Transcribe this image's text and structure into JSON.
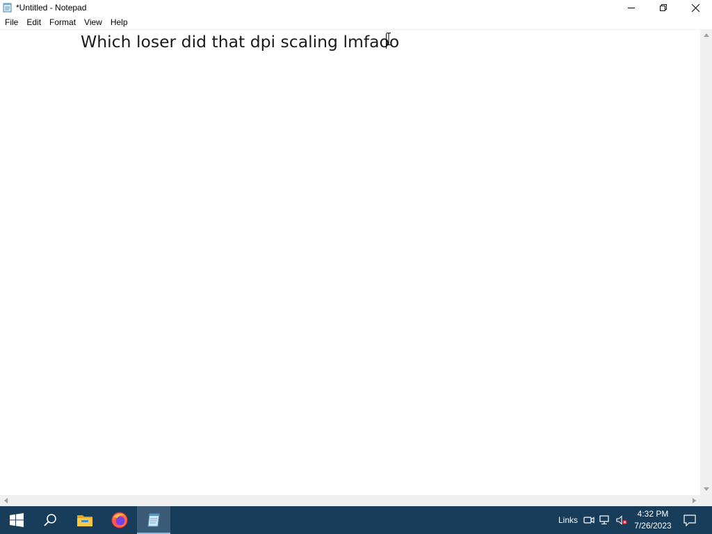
{
  "window": {
    "title": "*Untitled - Notepad"
  },
  "menu": {
    "items": [
      "File",
      "Edit",
      "Format",
      "View",
      "Help"
    ]
  },
  "editor": {
    "content": "Which loser did that dpi scaling lmfaoo"
  },
  "taskbar": {
    "icons": [
      "windows-start-icon",
      "search-icon",
      "file-explorer-icon",
      "firefox-icon",
      "notepad-icon"
    ],
    "links_label": "Links",
    "tray_icons": [
      "meet-now-icon",
      "network-icon",
      "volume-muted-icon",
      "notification-icon"
    ],
    "time": "4:32 PM",
    "date": "7/26/2023"
  },
  "colors": {
    "taskbar_bg": "#183d5a",
    "taskbar_active": "#3b5a75",
    "window_bg": "#ffffff",
    "scrollbar_bg": "#f0f0f0"
  }
}
